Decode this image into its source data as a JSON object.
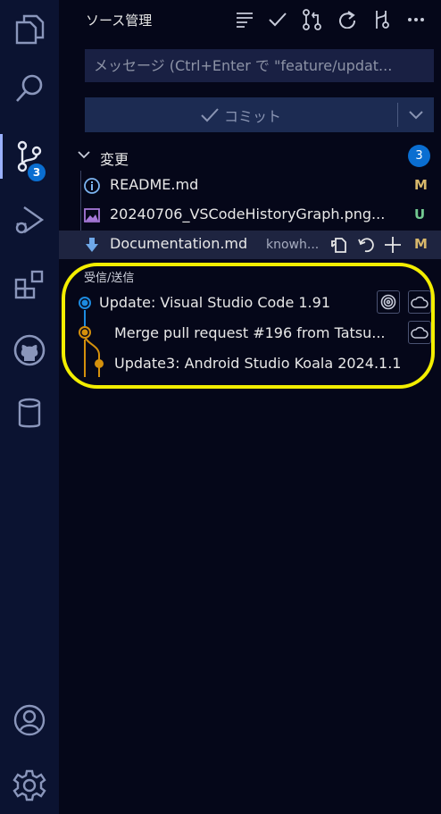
{
  "sidebar": {
    "title": "ソース管理",
    "message_placeholder": "メッセージ (Ctrl+Enter で \"feature/updat...",
    "commit_label": "コミット",
    "changes_label": "変更",
    "changes_count": "3",
    "scm_badge": "3",
    "files": [
      {
        "name": "README.md",
        "description": "",
        "status": "M",
        "icon": "info-icon"
      },
      {
        "name": "20240706_VSCodeHistoryGraph.png...",
        "description": "",
        "status": "U",
        "icon": "image-file-icon"
      },
      {
        "name": "Documentation.md",
        "description": "knowh...",
        "status": "M",
        "icon": "markdown-down-arrow-icon"
      }
    ],
    "graph_title": "受信/送信",
    "graph_items": [
      {
        "label": "Update: Visual Studio Code 1.91"
      },
      {
        "label": "Merge pull request #196 from Tatsu..."
      },
      {
        "label": "Update3: Android Studio Koala 2024.1.1"
      }
    ]
  },
  "colors": {
    "accent_blue": "#1d8be0",
    "commit_orange": "#d4900c",
    "modified": "#d8b86b",
    "untracked": "#73c991",
    "highlight": "#f3ee00"
  }
}
